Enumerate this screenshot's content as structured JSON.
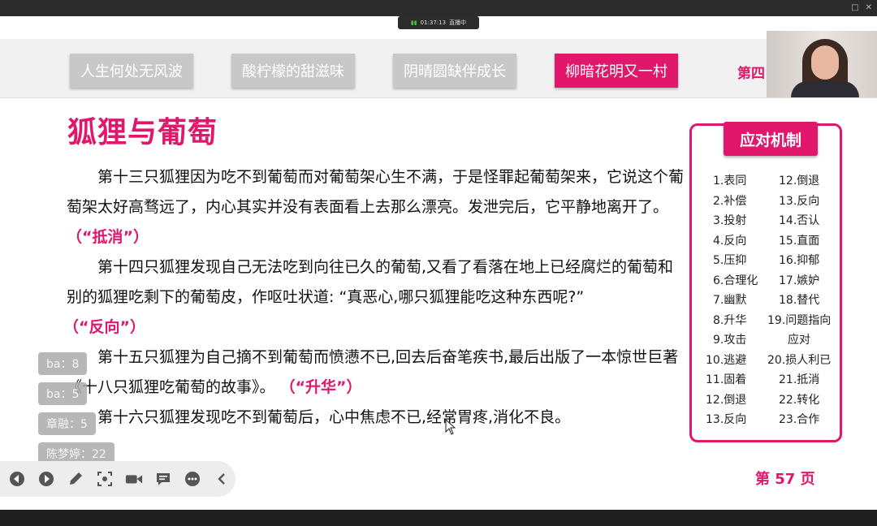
{
  "status_bar": {
    "time": "01:37:13",
    "live_label": "直播中"
  },
  "nav": {
    "tabs": [
      "人生何处无风波",
      "酸柠檬的甜滋味",
      "阴晴圆缺伴成长",
      "柳暗花明又一村"
    ],
    "active_tab": 3,
    "partial_tab": "第四"
  },
  "slide": {
    "title": "狐狸与葡萄",
    "paragraphs": {
      "p1": {
        "text": "第十三只狐狸因为吃不到葡萄而对葡萄架心生不满，于是怪罪起葡萄架来，它说这个葡萄架太好高骛远了，内心其实并没有表面看上去那么漂亮。发泄完后，它平静地离开了。",
        "tag": "（“抵消”）"
      },
      "p2": {
        "text": "第十四只狐狸发现自己无法吃到向往已久的葡萄,又看了看落在地上已经腐烂的葡萄和别的狐狸吃剩下的葡萄皮，作呕吐状道: “真恶心,哪只狐狸能吃这种东西呢?”",
        "tag": "（“反向”）"
      },
      "p3": {
        "text": "第十五只狐狸为自己摘不到葡萄而愤懑不已,回去后奋笔疾书,最后出版了一本惊世巨著《十八只狐狸吃葡萄的故事》。",
        "tag": "（“升华”）"
      },
      "p4": {
        "text": "第十六只狐狸发现吃不到葡萄后，心中焦虑不已,经常胃疼,消化不良。"
      }
    },
    "mechanism": {
      "title": "应对机制",
      "left": [
        "1.表同",
        "2.补偿",
        "3.投射",
        "4.反向",
        "5.压抑",
        "6.合理化",
        "7.幽默",
        "8.升华",
        "9.攻击",
        "10.逃避",
        "11.固着",
        "12.倒退",
        "13.反向"
      ],
      "right": [
        "12.倒退",
        "13.反向",
        "14.否认",
        "15.直面",
        "16.抑郁",
        "17.嫉妒",
        "18.替代",
        "19.问题指向",
        "应对",
        "20.损人利已",
        "21.抵消",
        "22.转化",
        "23.合作"
      ]
    },
    "page_number": "第 57 页"
  },
  "chat_overlay": [
    "ba：8",
    "ba：5",
    "章融：5",
    "陈梦婷：22"
  ],
  "toolbar_icons": [
    "prev-icon",
    "next-icon",
    "pen-icon",
    "screenshot-icon",
    "camera-icon",
    "comment-icon",
    "more-icon",
    "collapse-icon"
  ],
  "colors": {
    "accent": "#e0176b",
    "tab_inactive": "#c8c8c8"
  }
}
